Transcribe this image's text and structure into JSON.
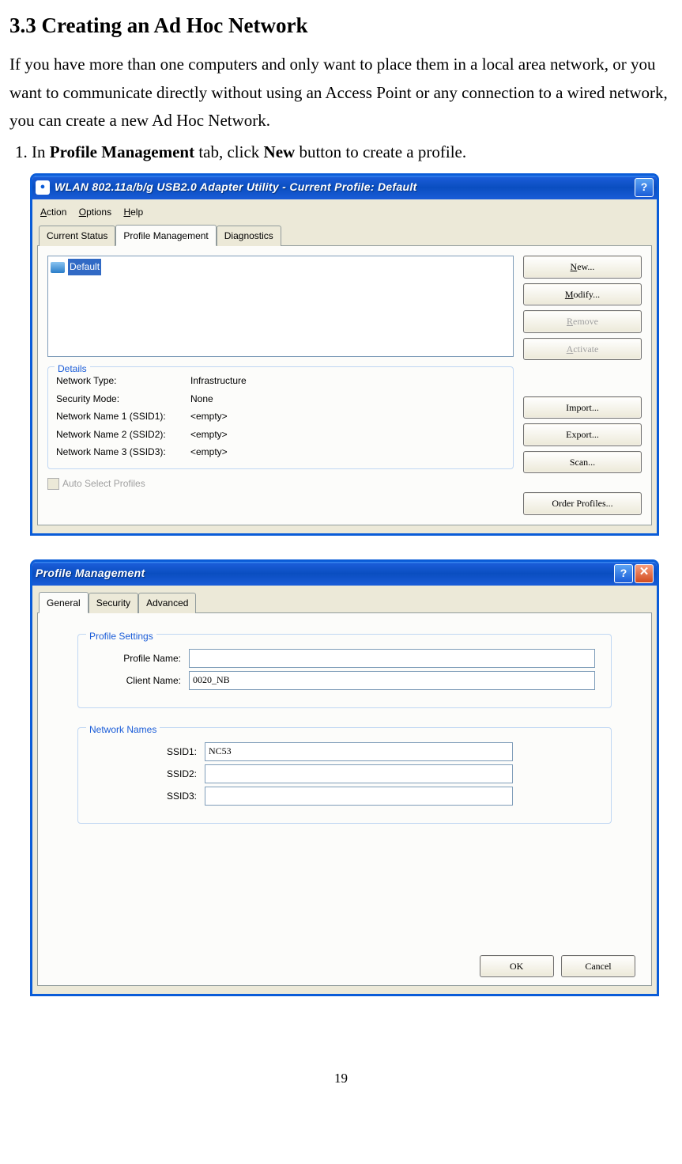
{
  "heading": "3.3 Creating an Ad Hoc Network",
  "intro": "If you have more than one computers and only want to place them in a local area network, or you want to communicate directly without using an Access Point or any connection to a wired network, you can create a new Ad Hoc Network.",
  "step1_prefix": "In ",
  "step1_bold1": "Profile Management",
  "step1_mid": " tab, click ",
  "step1_bold2": "New",
  "step1_suffix": " button to create a profile.",
  "win1": {
    "title": "WLAN 802.11a/b/g USB2.0 Adapter Utility - Current Profile: Default",
    "menu": {
      "action": "Action",
      "options": "Options",
      "help": "Help"
    },
    "tabs": {
      "status": "Current Status",
      "profile": "Profile Management",
      "diag": "Diagnostics"
    },
    "profile_item": "Default",
    "buttons": {
      "new": "New...",
      "modify": "Modify...",
      "remove": "Remove",
      "activate": "Activate",
      "import": "Import...",
      "export": "Export...",
      "scan": "Scan...",
      "order": "Order Profiles..."
    },
    "details": {
      "legend": "Details",
      "rows": [
        {
          "label": "Network Type:",
          "value": "Infrastructure"
        },
        {
          "label": "Security Mode:",
          "value": "None"
        },
        {
          "label": "Network Name 1 (SSID1):",
          "value": "<empty>"
        },
        {
          "label": "Network Name 2 (SSID2):",
          "value": "<empty>"
        },
        {
          "label": "Network Name 3 (SSID3):",
          "value": "<empty>"
        }
      ],
      "auto_select": "Auto Select Profiles"
    }
  },
  "win2": {
    "title": "Profile Management",
    "tabs": {
      "general": "General",
      "security": "Security",
      "advanced": "Advanced"
    },
    "profile_settings": {
      "legend": "Profile Settings",
      "profile_name_label": "Profile Name:",
      "profile_name_value": "",
      "client_name_label": "Client Name:",
      "client_name_value": "0020_NB"
    },
    "network_names": {
      "legend": "Network Names",
      "ssid1_label": "SSID1:",
      "ssid1_value": "NC53",
      "ssid2_label": "SSID2:",
      "ssid2_value": "",
      "ssid3_label": "SSID3:",
      "ssid3_value": ""
    },
    "ok": "OK",
    "cancel": "Cancel"
  },
  "page_number": "19"
}
